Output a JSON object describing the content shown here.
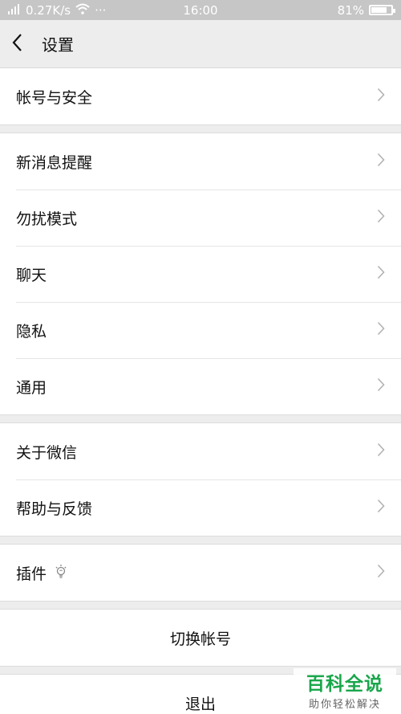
{
  "status_bar": {
    "signal_text": "0.27K/s",
    "more": "···",
    "time": "16:00",
    "battery": "81%",
    "battery_level": 0.81
  },
  "nav": {
    "title": "设置"
  },
  "groups": [
    {
      "items": [
        {
          "label": "帐号与安全"
        }
      ]
    },
    {
      "items": [
        {
          "label": "新消息提醒"
        },
        {
          "label": "勿扰模式"
        },
        {
          "label": "聊天"
        },
        {
          "label": "隐私"
        },
        {
          "label": "通用"
        }
      ]
    },
    {
      "items": [
        {
          "label": "关于微信"
        },
        {
          "label": "帮助与反馈"
        }
      ]
    },
    {
      "items": [
        {
          "label": "插件",
          "icon": "bulb-icon"
        }
      ]
    }
  ],
  "actions": {
    "switch_account": "切换帐号",
    "logout": "退出"
  },
  "watermark": {
    "title": "百科全说",
    "subtitle": "助你轻松解决"
  },
  "colors": {
    "status_bar": "#c6c6c6",
    "background": "#ededed",
    "watermark_green": "#1aa64b"
  }
}
